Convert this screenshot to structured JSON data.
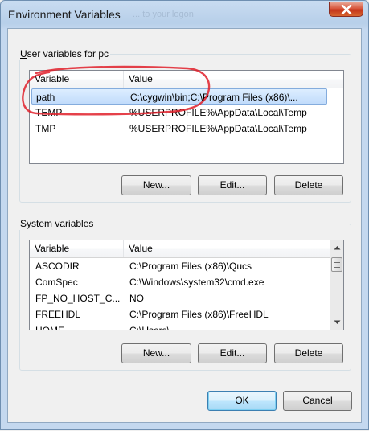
{
  "window": {
    "title": "Environment Variables",
    "ghost_text": "... to your logon"
  },
  "user_vars": {
    "label": "User variables for pc",
    "col_variable": "Variable",
    "col_value": "Value",
    "rows": [
      {
        "variable": "path",
        "value": "C:\\cygwin\\bin;C:\\Program Files (x86)\\...",
        "selected": true
      },
      {
        "variable": "TEMP",
        "value": "%USERPROFILE%\\AppData\\Local\\Temp"
      },
      {
        "variable": "TMP",
        "value": "%USERPROFILE%\\AppData\\Local\\Temp"
      }
    ],
    "buttons": {
      "new": "New...",
      "edit": "Edit...",
      "delete": "Delete"
    }
  },
  "system_vars": {
    "label": "System variables",
    "col_variable": "Variable",
    "col_value": "Value",
    "rows": [
      {
        "variable": "ASCODIR",
        "value": "C:\\Program Files (x86)\\Qucs"
      },
      {
        "variable": "ComSpec",
        "value": "C:\\Windows\\system32\\cmd.exe"
      },
      {
        "variable": "FP_NO_HOST_C...",
        "value": "NO"
      },
      {
        "variable": "FREEHDL",
        "value": "C:\\Program Files (x86)\\FreeHDL"
      },
      {
        "variable": "HOME",
        "value": "C:\\Users\\..."
      }
    ],
    "buttons": {
      "new": "New...",
      "edit": "Edit...",
      "delete": "Delete"
    }
  },
  "footer": {
    "ok": "OK",
    "cancel": "Cancel"
  },
  "colors": {
    "annotation": "#e0202a",
    "selection": "#c1dcfb"
  },
  "icons": [
    "close-icon",
    "scroll-up-icon",
    "scroll-down-icon",
    "scroll-grip-icon"
  ]
}
